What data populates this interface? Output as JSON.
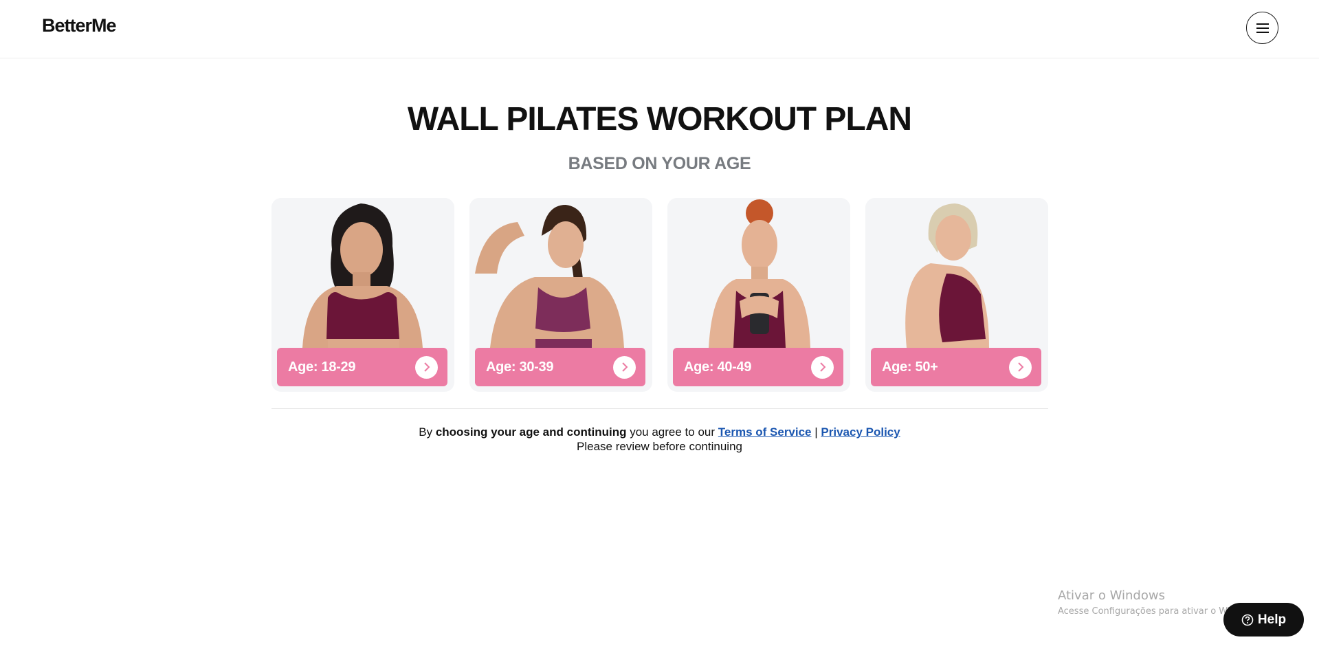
{
  "header": {
    "logo": "BetterMe",
    "menu_icon": "hamburger-menu-icon"
  },
  "hero": {
    "title": "WALL PILATES WORKOUT PLAN",
    "subtitle": "BASED ON YOUR AGE"
  },
  "age_options": [
    {
      "label": "Age: 18-29",
      "icon": "chevron-right-icon"
    },
    {
      "label": "Age: 30-39",
      "icon": "chevron-right-icon"
    },
    {
      "label": "Age: 40-49",
      "icon": "chevron-right-icon"
    },
    {
      "label": "Age: 50+",
      "icon": "chevron-right-icon"
    }
  ],
  "legal": {
    "prefix": "By ",
    "bold": "choosing your age and continuing",
    "middle": " you agree to our ",
    "terms_link": "Terms of Service",
    "separator": " | ",
    "privacy_link": "Privacy Policy",
    "line2": "Please review before continuing"
  },
  "watermark": {
    "title": "Ativar o Windows",
    "subtitle": "Acesse Configurações para ativar o Windows."
  },
  "help": {
    "label": "Help",
    "icon": "question-circle-icon"
  },
  "colors": {
    "accent_pink": "#ec7ba3",
    "card_bg": "#f4f5f7",
    "link_blue": "#1a56b0",
    "subtitle_gray": "#777b80",
    "outfit_plum": "#6b1538"
  }
}
